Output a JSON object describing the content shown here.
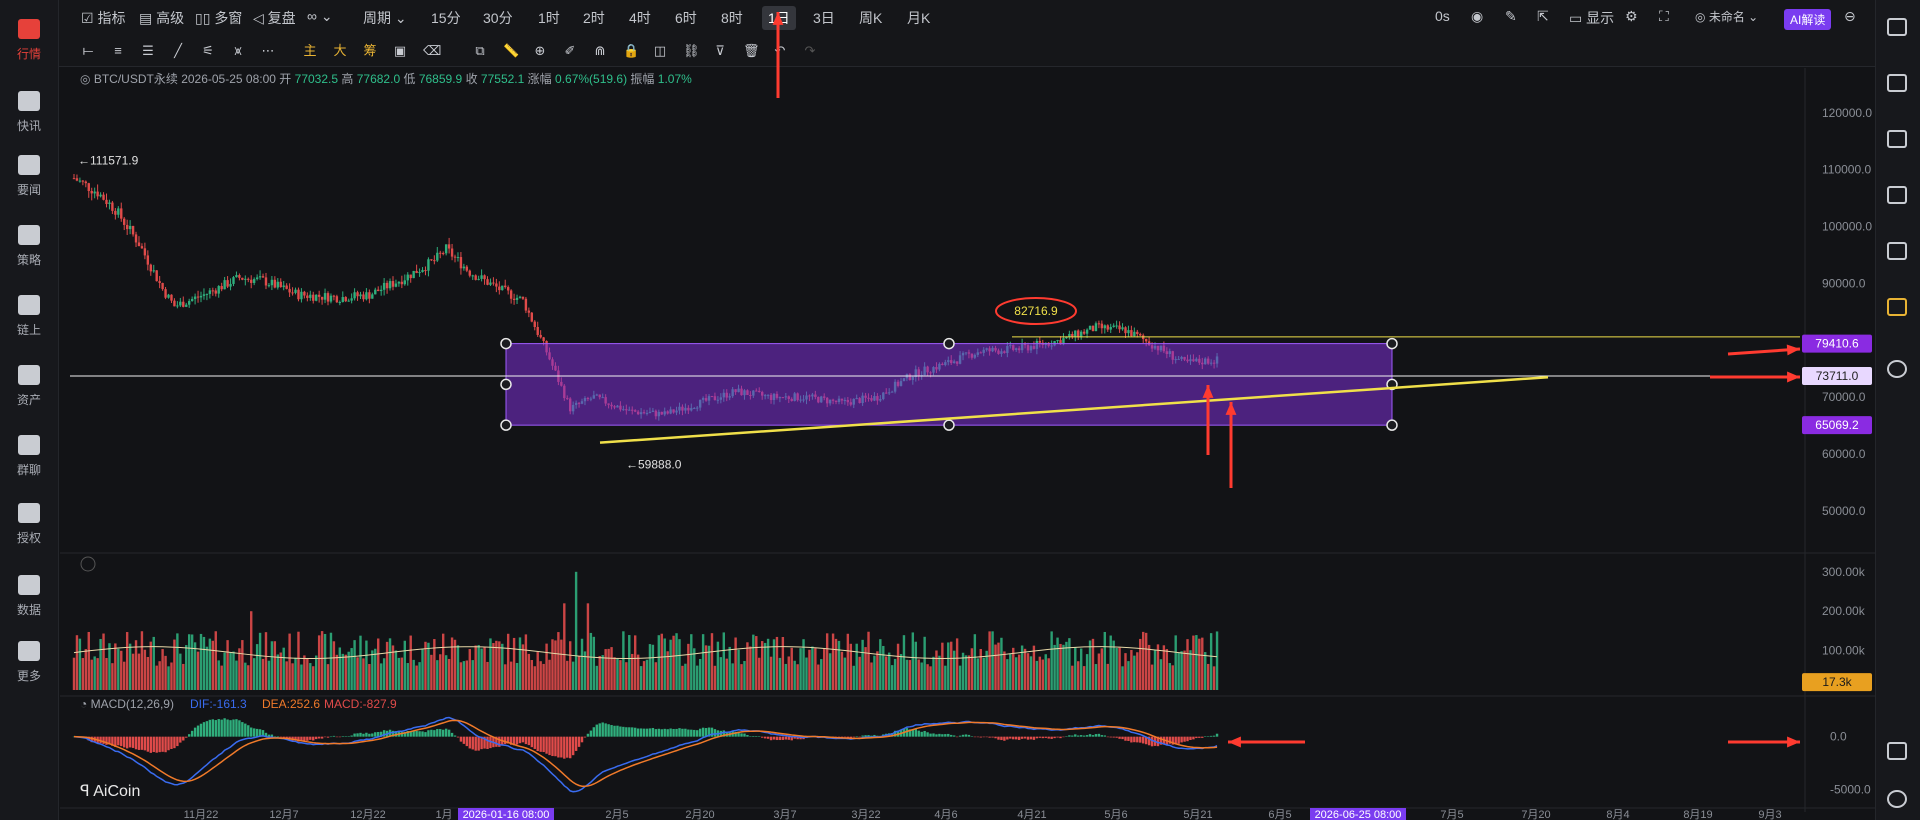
{
  "sidebar": {
    "items": [
      {
        "label": "行情",
        "icon": "bar-chart-icon",
        "active": true
      },
      {
        "label": "快讯",
        "icon": "flash-news-icon"
      },
      {
        "label": "要闻",
        "icon": "document-icon"
      },
      {
        "label": "策略",
        "icon": "robot-icon"
      },
      {
        "label": "链上",
        "icon": "chain-icon"
      },
      {
        "label": "资产",
        "icon": "wallet-icon"
      },
      {
        "label": "群聊",
        "icon": "chat-icon"
      },
      {
        "label": "授权",
        "icon": "key-icon"
      },
      {
        "label": "数据",
        "icon": "monitor-icon"
      },
      {
        "label": "更多",
        "icon": "grid-icon"
      }
    ]
  },
  "topbar": {
    "indicator": "指标",
    "advanced": "高级",
    "multi_window": "多窗",
    "replay": "复盘",
    "period": "周期",
    "intervals": [
      "15分",
      "30分",
      "1时",
      "2时",
      "4时",
      "6时",
      "8时",
      "1日",
      "3日",
      "周K",
      "月K"
    ],
    "active_interval": "1日",
    "timer": "0s",
    "display": "显示",
    "layout_name": "未命名",
    "ai_button": "AI解读"
  },
  "info": {
    "symbol": "BTC/USDT永续",
    "datetime": "2026-05-25 08:00",
    "open_label": "开",
    "open": "77032.5",
    "high_label": "高",
    "high": "77682.0",
    "low_label": "低",
    "low": "76859.9",
    "close_label": "收",
    "close": "77552.1",
    "change_label": "涨幅",
    "change": "0.67%(519.6)",
    "amplitude_label": "振幅",
    "amplitude": "1.07%"
  },
  "chart_data": {
    "type": "candlestick",
    "price_axis": [
      "120000.0",
      "110000.0",
      "100000.0",
      "90000.0",
      "80000.0",
      "70000.0",
      "60000.0",
      "50000.0"
    ],
    "ylim": [
      44000,
      124000
    ],
    "x_axis": [
      "11月22",
      "12月7",
      "12月22",
      "1月",
      "2026-01-16 08:00",
      "2月5",
      "2月20",
      "3月7",
      "3月22",
      "4月6",
      "4月21",
      "5月6",
      "5月21",
      "6月5",
      "2026-06-25 08:00",
      "7月5",
      "7月20",
      "8月4",
      "8月19",
      "9月3"
    ],
    "high_marker": "111571.9",
    "low_marker": "59888.0",
    "annotation": "82716.9",
    "price_tags": [
      {
        "value": "79410.6",
        "color": "#8a2be2"
      },
      {
        "value": "73711.0",
        "color": "#e8d8ff"
      },
      {
        "value": "65069.2",
        "color": "#8a2be2"
      }
    ],
    "rectangle": {
      "top": 79410.6,
      "bottom": 65069.2
    },
    "horizontal_line": 73711.0,
    "yellow_line": 80600,
    "volume_axis": [
      "300.00k",
      "200.00k",
      "100.00k"
    ],
    "volume_ylim": [
      0,
      330000
    ],
    "volume_tag": "17.3k",
    "macd_label": "MACD(12,26,9)",
    "macd_dif": "DIF:-161.3",
    "macd_dea": "DEA:252.6",
    "macd_value": "MACD:-827.9",
    "macd_axis": [
      "0.0",
      "-5000.0"
    ],
    "macd_ylim": [
      -6000,
      3000
    ]
  },
  "brand": "AiCoin",
  "colors": {
    "up": "#2fae7c",
    "down": "#e04b4a",
    "rect": "#7b2fd6",
    "yellow": "#f0e04a",
    "arrow": "#ff3b30"
  }
}
